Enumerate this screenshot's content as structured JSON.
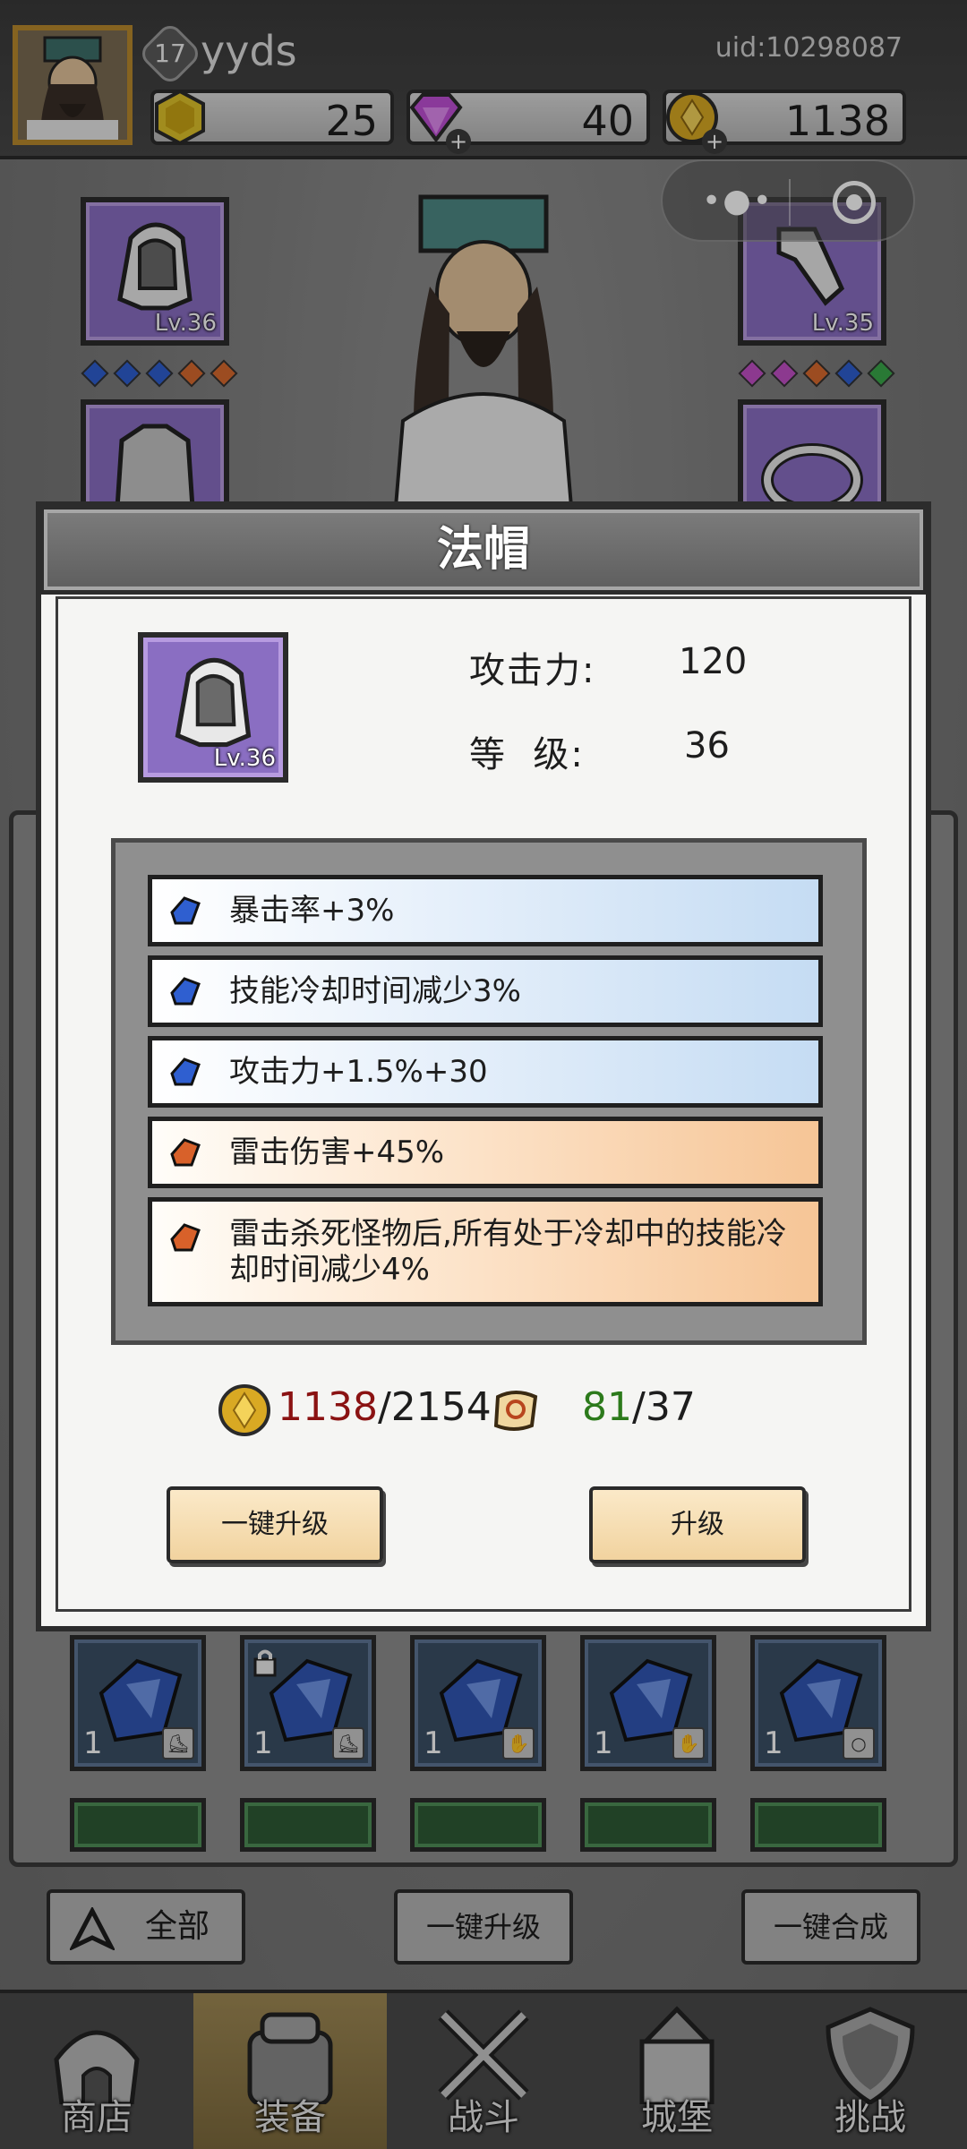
{
  "header": {
    "level": "17",
    "username": "yyds",
    "uid": "uid:10298087",
    "resources": [
      {
        "name": "stamina",
        "icon": "gold-hexagon-icon",
        "value": "25"
      },
      {
        "name": "gems",
        "icon": "purple-gem-icon",
        "value": "40"
      },
      {
        "name": "coins",
        "icon": "gold-coin-icon",
        "value": "1138"
      }
    ]
  },
  "equipment": {
    "left_top_level": "Lv.36",
    "right_top_level": "Lv.35"
  },
  "modal": {
    "title": "法帽",
    "item_level": "Lv.36",
    "stats": [
      {
        "label": "攻击力:",
        "value": "120"
      },
      {
        "label": "等  级:",
        "value": "36"
      }
    ],
    "affixes": [
      {
        "text": "暴击率+3%",
        "tier": "blue"
      },
      {
        "text": "技能冷却时间减少3%",
        "tier": "blue"
      },
      {
        "text": "攻击力+1.5%+30",
        "tier": "blue"
      },
      {
        "text": "雷击伤害+45%",
        "tier": "orange"
      },
      {
        "text": "雷击杀死怪物后,所有处于冷却中的技能冷却时间减少4%",
        "tier": "orange"
      }
    ],
    "cost_gold_have": "1138",
    "cost_gold_need": "/2154",
    "cost_scroll_have": "81",
    "cost_scroll_need": "/37",
    "btn_one_key": "一键升级",
    "btn_upgrade": "升级"
  },
  "inventory": {
    "counts": [
      "1",
      "1",
      "1",
      "1",
      "1"
    ]
  },
  "bottom_bar": {
    "filter_all": "全部",
    "one_key_upgrade": "一键升级",
    "one_key_merge": "一键合成"
  },
  "nav": {
    "items": [
      {
        "label": "商店",
        "icon": "shop-hut-icon"
      },
      {
        "label": "装备",
        "icon": "backpack-icon"
      },
      {
        "label": "战斗",
        "icon": "crossed-swords-icon"
      },
      {
        "label": "城堡",
        "icon": "castle-icon"
      },
      {
        "label": "挑战",
        "icon": "shield-icon"
      }
    ]
  },
  "colors": {
    "accent_purple": "#8a6ec2",
    "affix_blue": "#c5dcf3",
    "affix_orange": "#f6c596",
    "cost_red": "#8a1212",
    "cost_green": "#2c7a1b"
  }
}
